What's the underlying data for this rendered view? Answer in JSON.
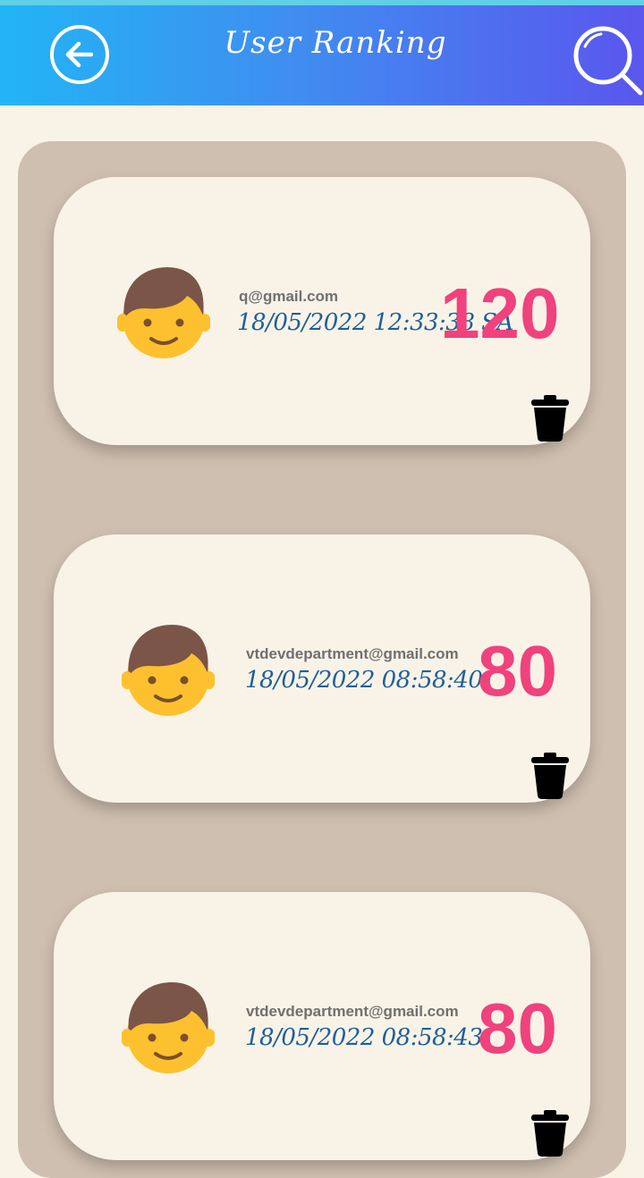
{
  "header": {
    "title": "User Ranking",
    "back_icon": "arrow-left-circle-icon",
    "search_icon": "search-icon"
  },
  "colors": {
    "header_gradient_start": "#22b5f5",
    "header_gradient_end": "#5a56ee",
    "score": "#f0427c",
    "date": "#1f5f9a",
    "panel": "#cfbfb0",
    "card": "#f9f3e7"
  },
  "rankings": [
    {
      "avatar_icon": "boy-face-icon",
      "email": "q@gmail.com",
      "datetime": "18/05/2022 12:33:38 SA",
      "score": "120",
      "delete_icon": "trash-icon"
    },
    {
      "avatar_icon": "boy-face-icon",
      "email": "vtdevdepartment@gmail.com",
      "datetime": "18/05/2022 08:58:40",
      "score": "80",
      "delete_icon": "trash-icon"
    },
    {
      "avatar_icon": "boy-face-icon",
      "email": "vtdevdepartment@gmail.com",
      "datetime": "18/05/2022 08:58:43",
      "score": "80",
      "delete_icon": "trash-icon"
    }
  ]
}
